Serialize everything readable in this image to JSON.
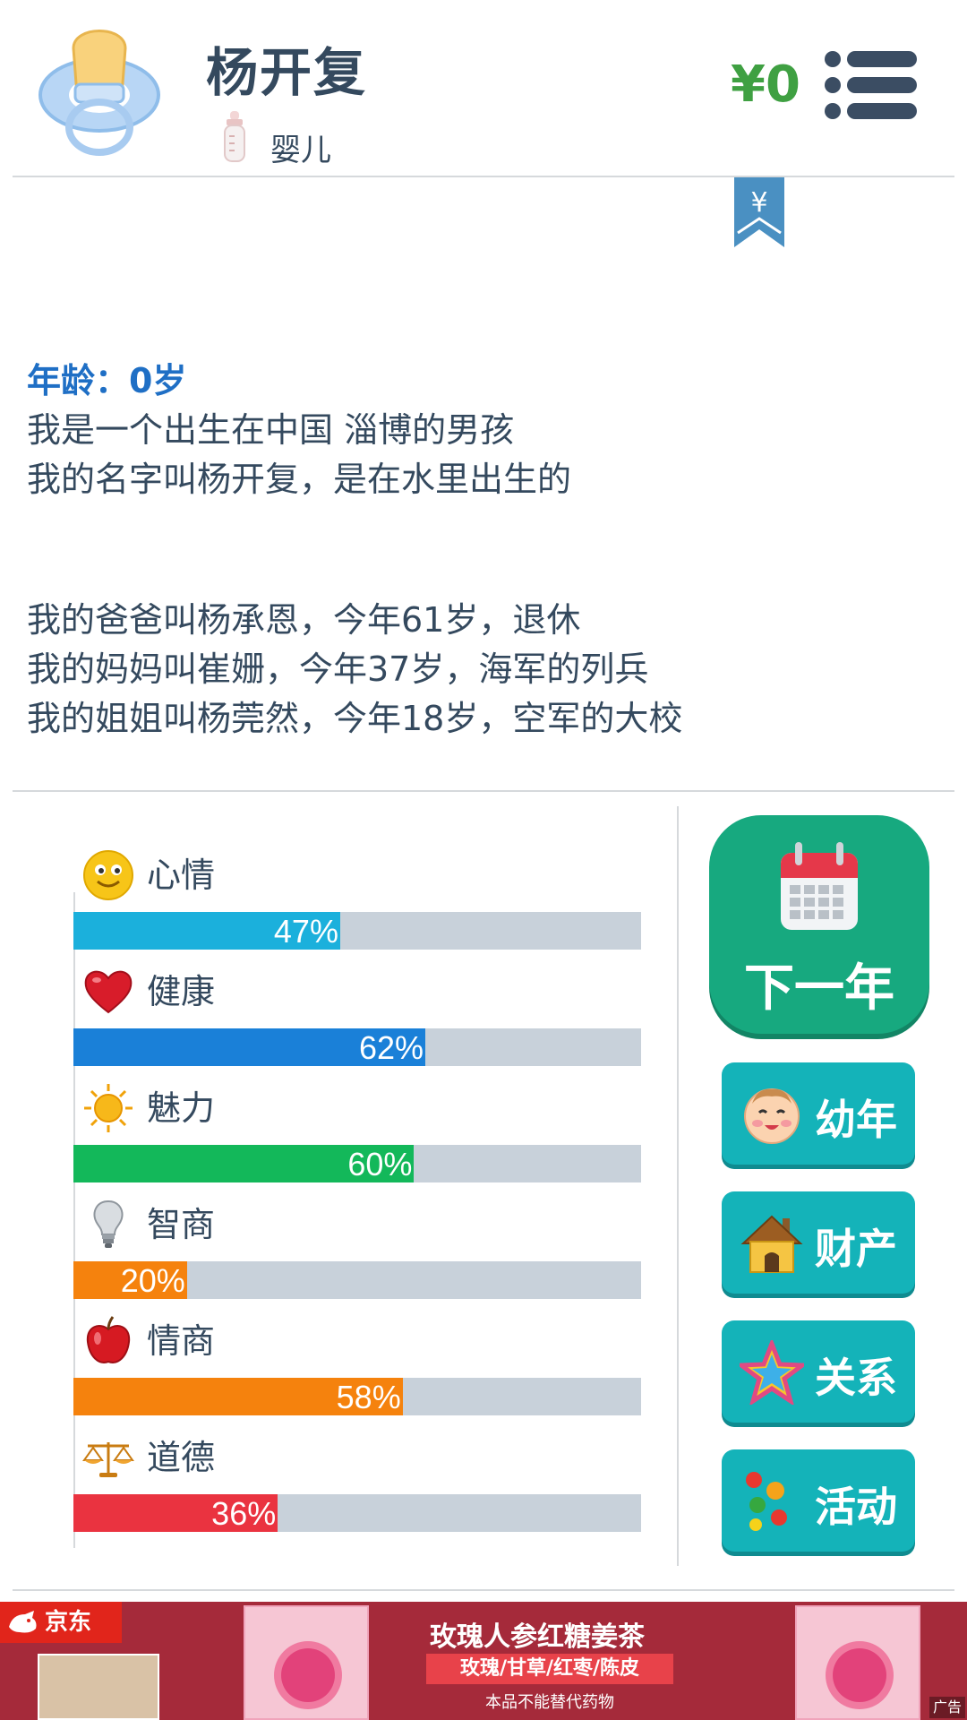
{
  "header": {
    "name": "杨开复",
    "stage": "婴儿",
    "money": "¥0"
  },
  "bookmark_symbol": "¥",
  "story": {
    "lines1": [
      "年龄：0岁",
      "我是一个出生在中国 淄博的男孩",
      "我的名字叫杨开复，是在水里出生的"
    ],
    "lines2": [
      "我的爸爸叫杨承恩，今年61岁，退休",
      "我的妈妈叫崔姗，今年37岁，海军的列兵",
      "我的姐姐叫杨莞然，今年18岁，空军的大校"
    ]
  },
  "stats": [
    {
      "label": "心情",
      "value": 47,
      "text": "47%",
      "color": "#1bb0dc",
      "icon": "smiley-icon"
    },
    {
      "label": "健康",
      "value": 62,
      "text": "62%",
      "color": "#1a80d8",
      "icon": "heart-icon"
    },
    {
      "label": "魅力",
      "value": 60,
      "text": "60%",
      "color": "#13b85a",
      "icon": "sun-icon"
    },
    {
      "label": "智商",
      "value": 20,
      "text": "20%",
      "color": "#f5820d",
      "icon": "lightbulb-icon"
    },
    {
      "label": "情商",
      "value": 58,
      "text": "58%",
      "color": "#f5820d",
      "icon": "apple-icon"
    },
    {
      "label": "道德",
      "value": 36,
      "text": "36%",
      "color": "#ea3340",
      "icon": "scales-icon"
    }
  ],
  "buttons": {
    "next_year": "下一年",
    "childhood": "幼年",
    "property": "财产",
    "relations": "关系",
    "activities": "活动"
  },
  "ad": {
    "brand": "京东",
    "title": "玫瑰人参红糖姜茶",
    "subtitle": "玫瑰/甘草/红枣/陈皮",
    "note": "本品不能替代药物",
    "tag": "广告"
  }
}
